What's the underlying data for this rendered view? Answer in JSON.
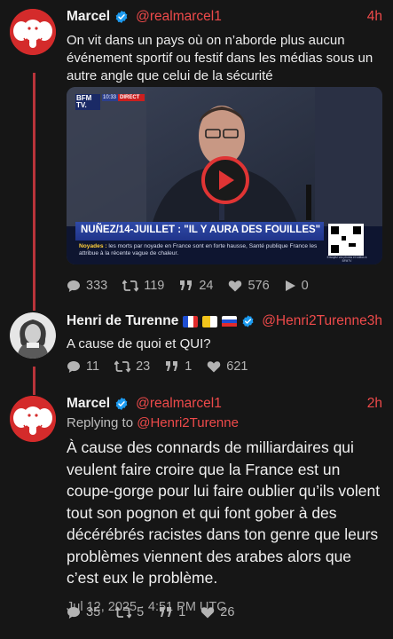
{
  "tweets": [
    {
      "name": "Marcel",
      "handle": "@realmarcel1",
      "time": "4h",
      "text": "On vit dans un pays où on n’aborde plus aucun événement sportif ou festif dans les médias sous un autre angle que celui de la sécurité",
      "media": {
        "channel": "BFM TV.",
        "clock": "10:33",
        "live": "DIRECT",
        "headline": "NUÑEZ/14-JUILLET : \"IL Y AURA DES FOUILLES\"",
        "ticker_label": "Noyades :",
        "ticker_text": "les morts par noyade en France sont en forte hausse, Santé publique France les attribue à la récente vague de chaleur.",
        "qr_caption": "Envoyez vos photos et vidéos à BFMTV"
      },
      "stats": {
        "replies": "333",
        "retweets": "119",
        "quotes": "24",
        "likes": "576",
        "views": "0"
      }
    },
    {
      "name": "Henri de Turenne",
      "handle": "@Henri2Turenne",
      "time": "3h",
      "text": "A cause de quoi et QUI?",
      "stats": {
        "replies": "11",
        "retweets": "23",
        "quotes": "1",
        "likes": "621"
      }
    },
    {
      "name": "Marcel",
      "handle": "@realmarcel1",
      "time": "2h",
      "reply_prefix": "Replying to",
      "reply_handle": "@Henri2Turenne",
      "text": "À cause des connards de milliardaires qui veulent faire croire que la France est un coupe-gorge pour lui faire oublier qu’ils volent tout son pognon et qui font gober à des décérébrés racistes dans ton genre que leurs problèmes viennent des arabes alors que c’est eux le problème.",
      "date": "Jul 12, 2025 · 4:51 PM UTC",
      "stats": {
        "replies": "35",
        "retweets": "5",
        "quotes": "1",
        "likes": "26"
      }
    }
  ],
  "colors": {
    "accent": "#ee4a4a",
    "thread_line": "#b8343a",
    "background": "#161616",
    "verified": "#1d9bf0"
  },
  "icons": [
    "verified-badge-icon",
    "comment-icon",
    "retweet-icon",
    "quote-icon",
    "heart-icon",
    "play-icon"
  ]
}
